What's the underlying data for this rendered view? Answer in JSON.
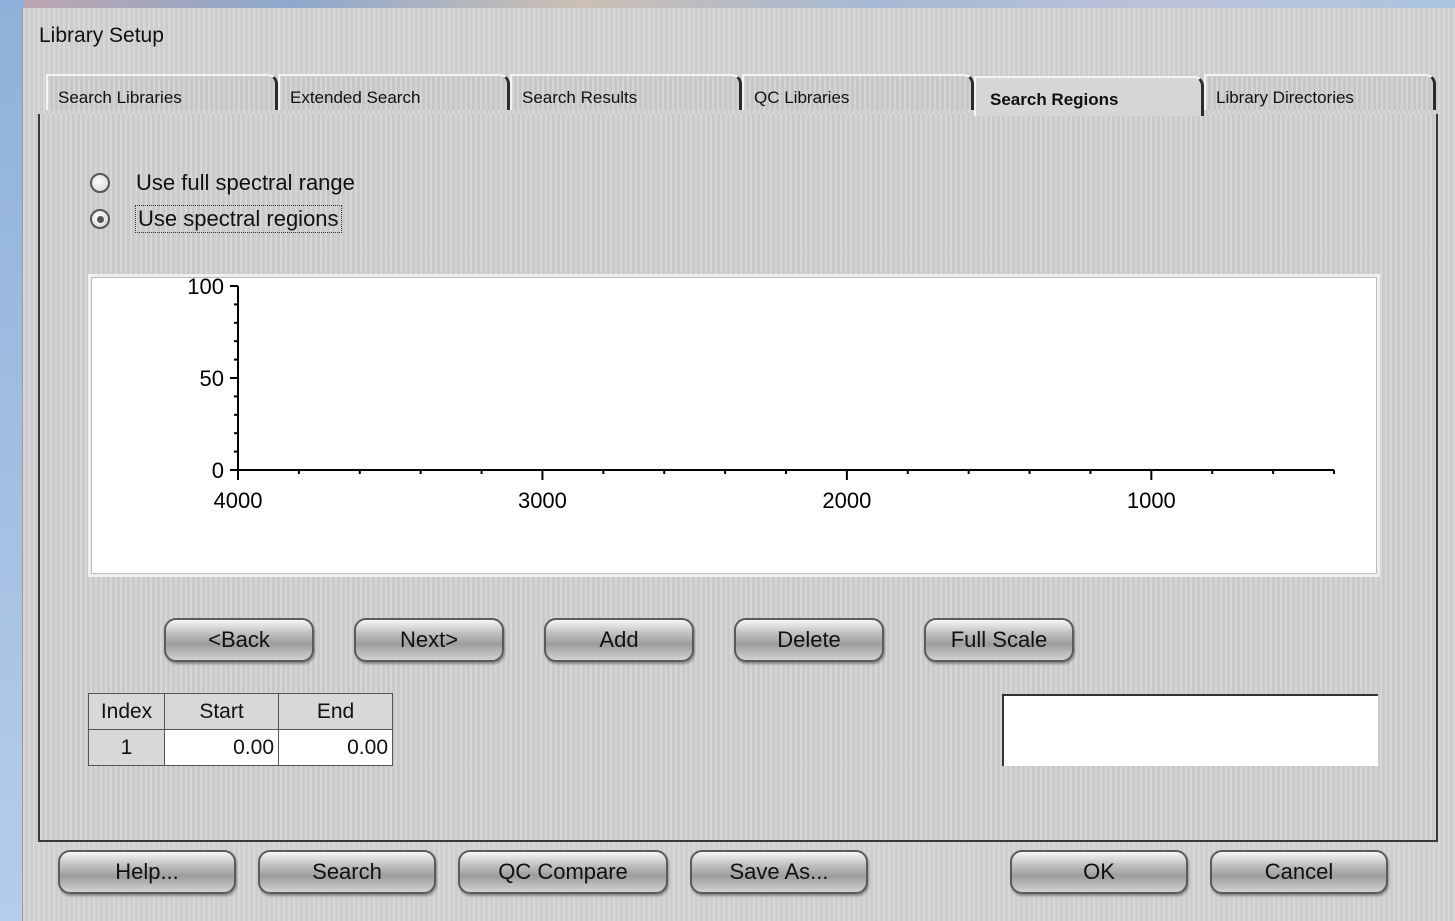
{
  "window": {
    "title": "Library Setup"
  },
  "tabs": [
    {
      "label": "Search Libraries"
    },
    {
      "label": "Extended Search"
    },
    {
      "label": "Search Results"
    },
    {
      "label": "QC Libraries"
    },
    {
      "label": "Search Regions",
      "active": true
    },
    {
      "label": "Library Directories"
    }
  ],
  "range_options": [
    {
      "label": "Use full spectral range",
      "checked": false
    },
    {
      "label": "Use spectral regions",
      "checked": true
    }
  ],
  "chart_data": {
    "type": "line",
    "series": [],
    "y_ticks": [
      "100",
      "50",
      "0"
    ],
    "x_ticks": [
      "4000",
      "3000",
      "2000",
      "1000"
    ],
    "ylim": [
      0,
      100
    ],
    "xlim": [
      4000,
      400
    ],
    "x_reversed": true
  },
  "region_buttons": {
    "back": "<Back",
    "next": "Next>",
    "add": "Add",
    "delete": "Delete",
    "full_scale": "Full Scale"
  },
  "regions_table": {
    "headers": [
      "Index",
      "Start",
      "End"
    ],
    "rows": [
      {
        "index": "1",
        "start": "0.00",
        "end": "0.00"
      }
    ]
  },
  "footer_buttons": {
    "help": "Help...",
    "search": "Search",
    "qc_compare": "QC Compare",
    "save_as": "Save As...",
    "ok": "OK",
    "cancel": "Cancel"
  }
}
